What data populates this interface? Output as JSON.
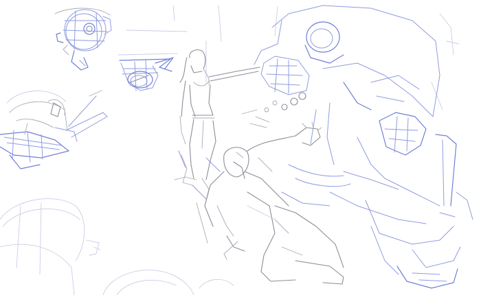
{
  "canvas": {
    "background": "#ffffff",
    "line_color_primary": "#8f9be0",
    "line_color_secondary": "#a9a9b8"
  },
  "figures": [
    {
      "id": "floating-orb-robot",
      "icon": "orb-robot-sketch"
    },
    {
      "id": "flying-drone",
      "icon": "drone-sketch"
    },
    {
      "id": "crouching-armored-figure",
      "icon": "armored-figure-sketch"
    },
    {
      "id": "standing-woman",
      "icon": "woman-sketch"
    },
    {
      "id": "hulking-brute",
      "icon": "brute-sketch"
    },
    {
      "id": "lunging-man",
      "icon": "man-sketch"
    },
    {
      "id": "foreground-rocks",
      "icon": "rocks-sketch"
    }
  ]
}
